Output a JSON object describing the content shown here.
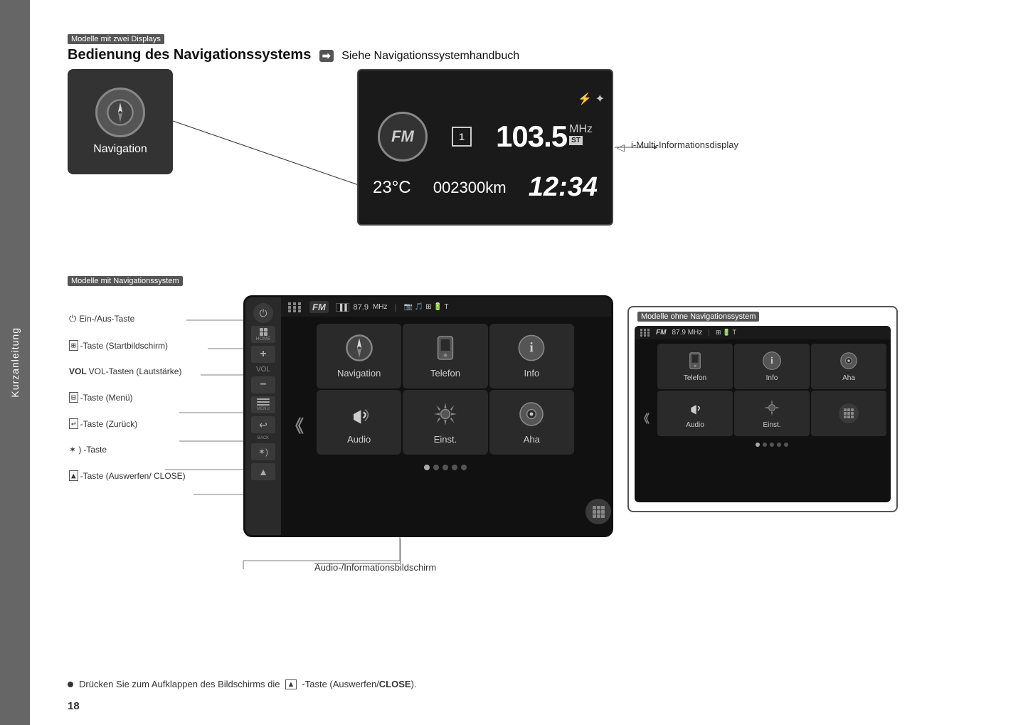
{
  "sidebar": {
    "label": "Kurzanleitung"
  },
  "page": {
    "number": "18",
    "top_label1": "Modelle mit zwei Displays",
    "heading": "Bedienung des Navigationssystems",
    "heading_arrow": "➡",
    "heading_suffix": "Siehe Navigationssystemhandbuch",
    "imulti_label": "i-Multi-Informationsdisplay",
    "section_nav_label": "Modelle mit Navigationssystem",
    "section_no_nav_label": "Modelle ohne Navigationssystem"
  },
  "nav_button": {
    "label": "Navigation"
  },
  "imulti": {
    "fm_label": "FM",
    "preset": "1",
    "frequency": "103.5",
    "freq_unit": "MHz",
    "st_badge": "ST",
    "temp": "23°C",
    "km": "002300km",
    "time": "12:34"
  },
  "controls": {
    "power_label": "Ein-/Aus-Taste",
    "home_label": "-Taste (Startbildschirm)",
    "vol_label": "VOL-Tasten (Lautstärke)",
    "menu_label": "-Taste (Menü)",
    "back_label": "-Taste (Zurück)",
    "dim_label": "-Taste",
    "eject_label": "-Taste (Auswerfen/ CLOSE)"
  },
  "screen_main": {
    "fm_label": "FM",
    "freq": "87.9",
    "freq_unit": "MHz",
    "tiles": [
      {
        "label": "Navigation",
        "icon": "nav"
      },
      {
        "label": "Telefon",
        "icon": "phone"
      },
      {
        "label": "Info",
        "icon": "info"
      },
      {
        "label": "Audio",
        "icon": "audio"
      },
      {
        "label": "Einst.",
        "icon": "settings"
      },
      {
        "label": "Aha",
        "icon": "aha"
      }
    ]
  },
  "screen_small": {
    "fm_label": "FM",
    "freq": "87.9",
    "freq_unit": "MHz",
    "tiles": [
      {
        "label": "Telefon",
        "icon": "phone"
      },
      {
        "label": "Info",
        "icon": "info"
      },
      {
        "label": "Aha",
        "icon": "aha"
      },
      {
        "label": "Audio",
        "icon": "audio"
      },
      {
        "label": "Einst.",
        "icon": "settings"
      }
    ]
  },
  "bottom_label": {
    "audio_screen": "Audio-/Informationsbildschirm"
  },
  "note": {
    "text": "Drücken Sie zum Aufklappen des Bildschirms die"
  },
  "note_bold": "-Taste (Auswerfen/CLOSE).",
  "note_icon": "▲"
}
